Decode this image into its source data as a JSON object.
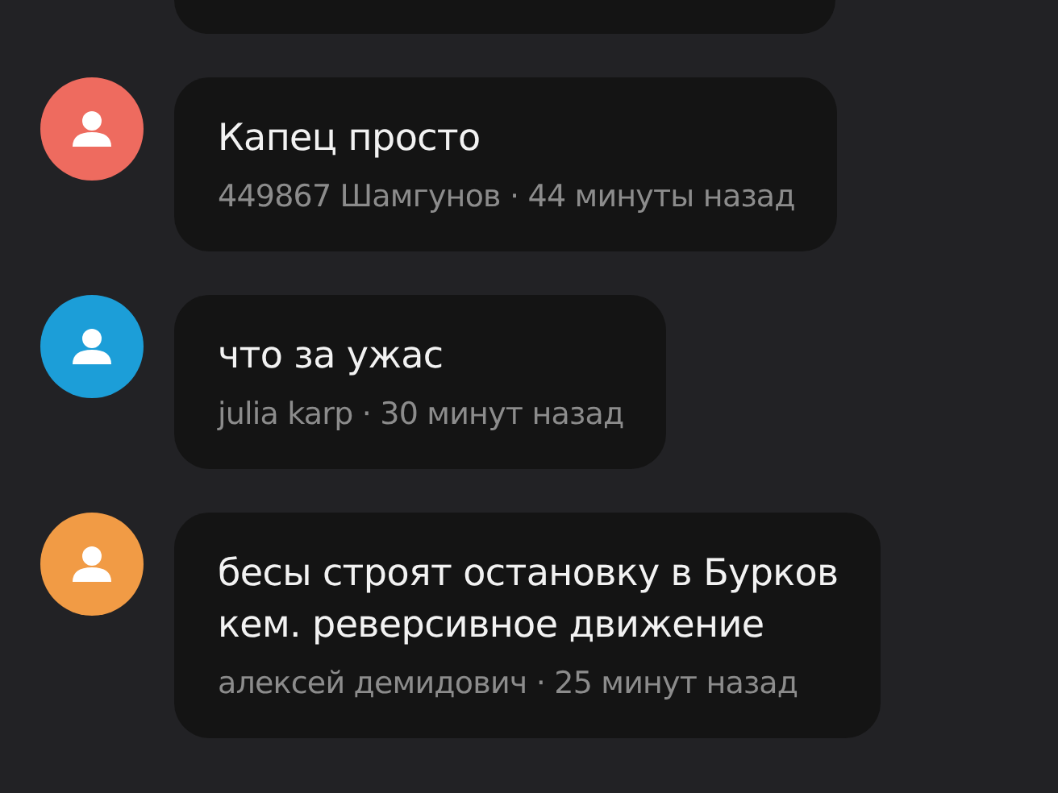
{
  "messages": [
    {
      "kind": "partial"
    },
    {
      "kind": "comment",
      "color": "#ee6b5f",
      "text": "Капец просто",
      "meta": "449867 Шамгунов · 44 минуты назад"
    },
    {
      "kind": "comment",
      "color": "#1c9ed8",
      "text": "что за ужас",
      "meta": "julia karp · 30 минут назад"
    },
    {
      "kind": "comment",
      "color": "#f19b45",
      "text": "бесы строят остановку в Бурков\nкем. реверсивное движение",
      "meta": "алексей демидович · 25 минут назад"
    }
  ]
}
